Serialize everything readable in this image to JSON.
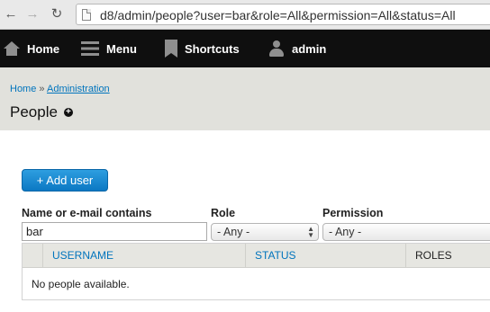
{
  "browser": {
    "url": "d8/admin/people?user=bar&role=All&permission=All&status=All",
    "back_icon": "arrow-left-icon",
    "forward_icon": "arrow-right-icon",
    "reload_icon": "reload-icon"
  },
  "toolbar": {
    "home_label": "Home",
    "menu_label": "Menu",
    "shortcuts_label": "Shortcuts",
    "user_label": "admin"
  },
  "breadcrumb": {
    "home": "Home",
    "separator": "»",
    "administration": "Administration"
  },
  "page": {
    "title": "People",
    "add_shortcut_symbol": "+"
  },
  "actions": {
    "add_user_label": "+ Add user"
  },
  "filters": {
    "name_label": "Name or e-mail contains",
    "name_value": "bar",
    "role_label": "Role",
    "role_value": "- Any -",
    "permission_label": "Permission",
    "permission_value": "- Any -"
  },
  "table": {
    "columns": [
      "USERNAME",
      "STATUS",
      "ROLES"
    ],
    "empty_message": "No people available."
  },
  "colors": {
    "toolbar_bg": "#0f0f0f",
    "link": "#0074bd",
    "button": "#1a87d0",
    "header_bg": "#e1e1dc"
  }
}
